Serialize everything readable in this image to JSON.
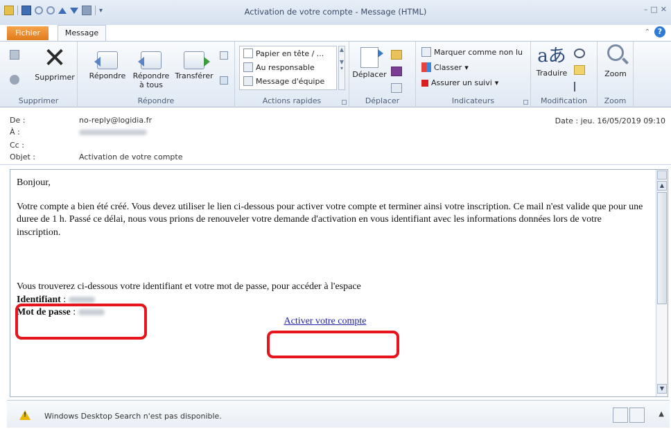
{
  "window": {
    "title": "Activation de votre compte  -  Message (HTML)",
    "controls": [
      "–",
      "□",
      "✕"
    ]
  },
  "tabs": {
    "file": "Fichier",
    "message": "Message"
  },
  "ribbon": {
    "delete": {
      "delete_label": "Supprimer",
      "group_label": "Supprimer"
    },
    "respond": {
      "reply": "Répondre",
      "reply_all_line1": "Répondre",
      "reply_all_line2": "à tous",
      "forward": "Transférer",
      "group_label": "Répondre"
    },
    "quick_steps": {
      "items": [
        "Papier en tête / ...",
        "Au responsable",
        "Message d'équipe"
      ],
      "group_label": "Actions rapides"
    },
    "move": {
      "move_label": "Déplacer",
      "group_label": "Déplacer"
    },
    "tags": {
      "mark_unread": "Marquer comme non lu",
      "categorize": "Classer",
      "follow_up": "Assurer un suivi",
      "group_label": "Indicateurs"
    },
    "editing": {
      "translate": "Traduire",
      "group_label": "Modification"
    },
    "zoom": {
      "zoom_label": "Zoom",
      "group_label": "Zoom"
    }
  },
  "header": {
    "from_label": "De :",
    "from_value": "no-reply@logidia.fr",
    "to_label": "À :",
    "cc_label": "Cc :",
    "subject_label": "Objet :",
    "subject_value": "Activation de votre compte",
    "date_label": "Date :",
    "date_value": "jeu. 16/05/2019 09:10"
  },
  "email": {
    "greeting": "Bonjour,",
    "paragraph": "Votre compte a bien été créé. Vous devez utiliser le lien ci-dessous pour activer votre compte et terminer ainsi votre inscription. Ce mail n'est valide que pour une duree de 1 h. Passé ce délai, nous vous prions de renouveler votre demande d'activation en vous identifiant avec les informations données lors de votre inscription.",
    "credentials_intro": "Vous trouverez ci-dessous votre identifiant et votre mot de passe, pour accéder à l'espace",
    "identifier_label": "Identifiant",
    "password_label": "Mot de passe",
    "separator": " : ",
    "activate_link": "Activer votre compte"
  },
  "status": {
    "text": "Windows Desktop Search n'est pas disponible."
  },
  "colors": {
    "highlight": "#e8141c",
    "link": "#1f1fa8",
    "file_tab": "#e07b1b"
  }
}
